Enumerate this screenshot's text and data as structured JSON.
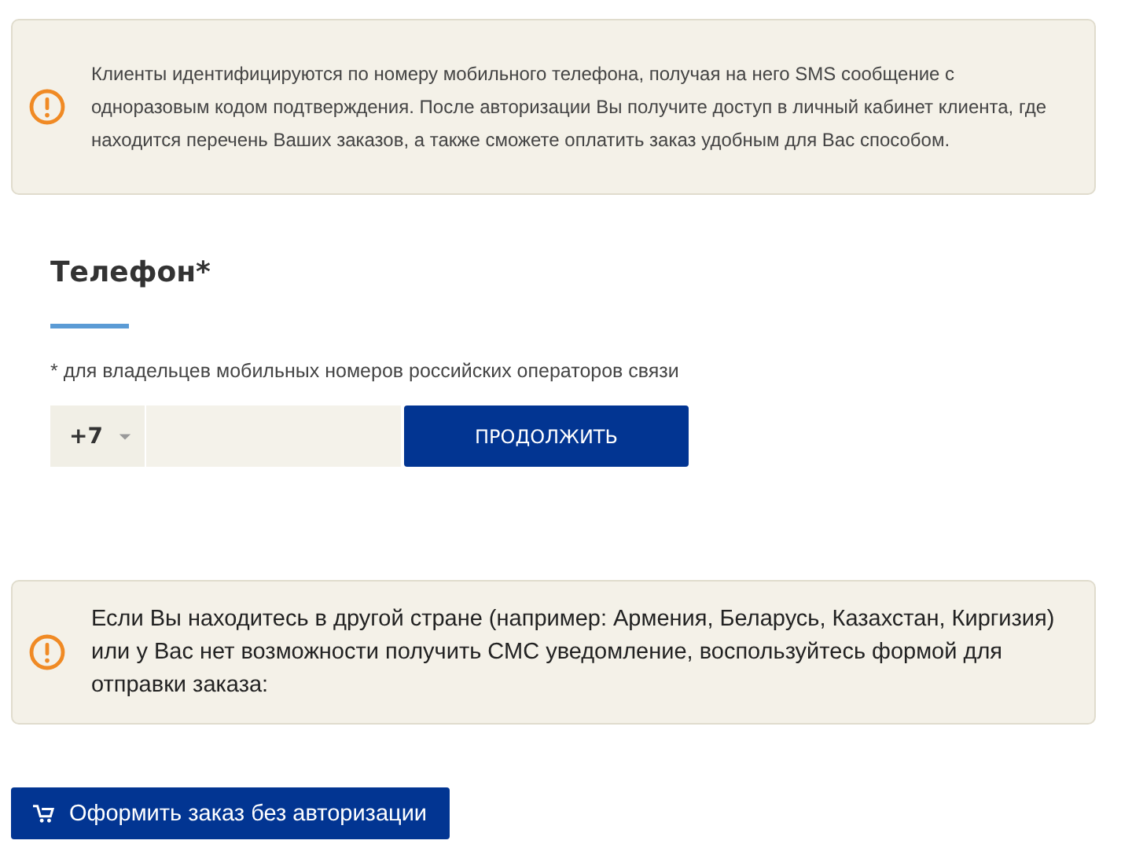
{
  "auth_section": {
    "notice": "Клиенты идентифицируются по номеру мобильного телефона, получая на него SMS сообщение с одноразовым кодом подтверждения. После авторизации Вы получите доступ в личный кабинет клиента, где находится перечень Ваших заказов, а также сможете оплатить заказ удобным для Вас способом.",
    "phone_label": "Телефон*",
    "phone_hint": "* для владельцев мобильных номеров российских операторов связи",
    "country_code": "+7",
    "continue_button": "ПРОДОЛЖИТЬ"
  },
  "foreign_notice": "Если Вы находитесь в другой стране (например: Армения, Беларусь, Казахстан, Киргизия) или у Вас нет возможности получить СМС уведомление, воспользуйтесь формой для отправки заказа:",
  "order_button": "Оформить заказ без авторизации"
}
